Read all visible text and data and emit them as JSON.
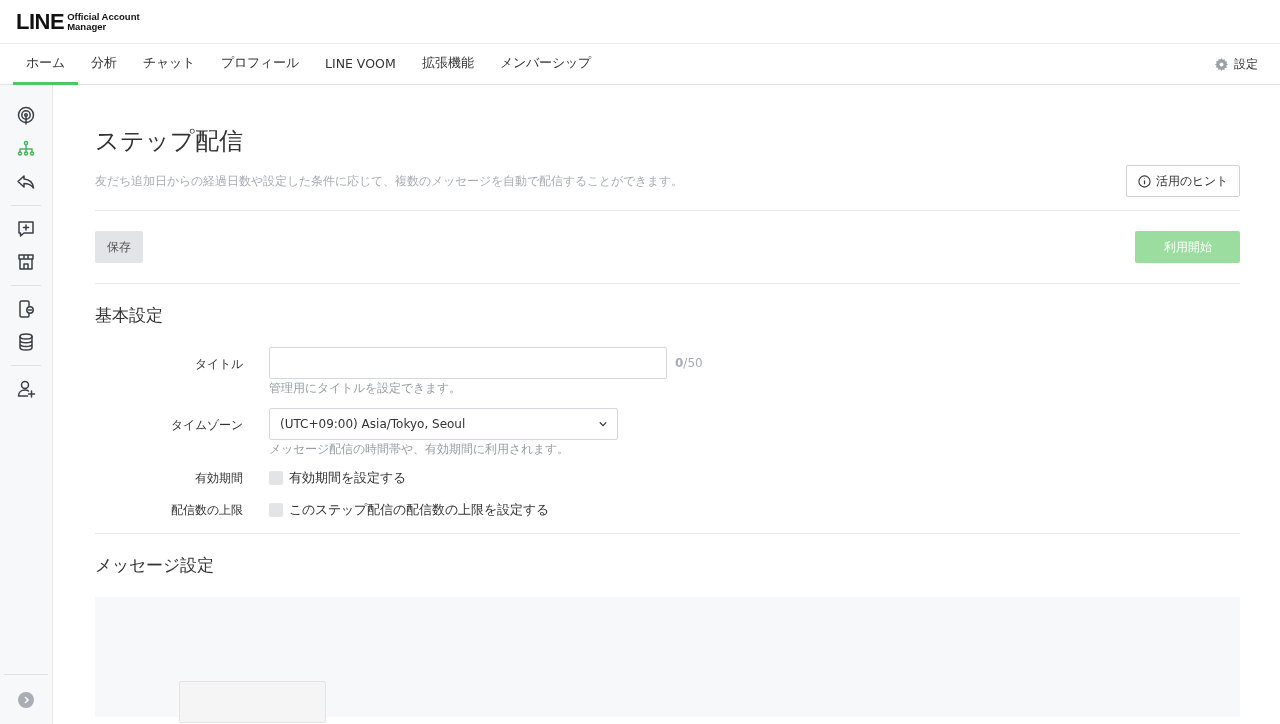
{
  "logo": {
    "brand": "LINE",
    "product": "Official Account Manager"
  },
  "tabs": [
    {
      "label": "ホーム",
      "selected": true
    },
    {
      "label": "分析",
      "selected": false
    },
    {
      "label": "チャット",
      "selected": false
    },
    {
      "label": "プロフィール",
      "selected": false
    },
    {
      "label": "LINE VOOM",
      "selected": false
    },
    {
      "label": "拡張機能",
      "selected": false
    },
    {
      "label": "メンバーシップ",
      "selected": false
    }
  ],
  "settings_link": "設定",
  "sidebar": {
    "groups": [
      [
        {
          "kind": "broadcast",
          "selected": false
        },
        {
          "kind": "step",
          "selected": true
        },
        {
          "kind": "reply",
          "selected": false
        }
      ],
      [
        {
          "kind": "message",
          "selected": false
        },
        {
          "kind": "shop",
          "selected": false
        }
      ],
      [
        {
          "kind": "phone",
          "selected": false
        },
        {
          "kind": "database",
          "selected": false
        }
      ],
      [
        {
          "kind": "user-add",
          "selected": false
        }
      ]
    ]
  },
  "page": {
    "title": "ステップ配信",
    "description": "友だち追加日からの経過日数や設定した条件に応じて、複数のメッセージを自動で配信することができます。",
    "hint_button": "活用のヒント",
    "save_button": "保存",
    "start_button": {
      "label": "利用開始",
      "disabled": true
    }
  },
  "basic": {
    "heading": "基本設定",
    "title_field": {
      "label": "タイトル",
      "counter": "**0**/50",
      "help": "管理用にタイトルを設定できます。"
    },
    "timezone": {
      "label": "タイムゾーン",
      "value": "(UTC+09:00) Asia/Tokyo, Seoul",
      "help": "メッセージ配信の時間帯や、有効期間に利用されます。"
    },
    "checks": [
      {
        "label": "有効期間",
        "text": "有効期間を設定する",
        "checked": false
      },
      {
        "label": "配信数の上限",
        "text": "このステップ配信の配信数の上限を設定する",
        "checked": false
      }
    ]
  },
  "message": {
    "heading": "メッセージ設定"
  }
}
